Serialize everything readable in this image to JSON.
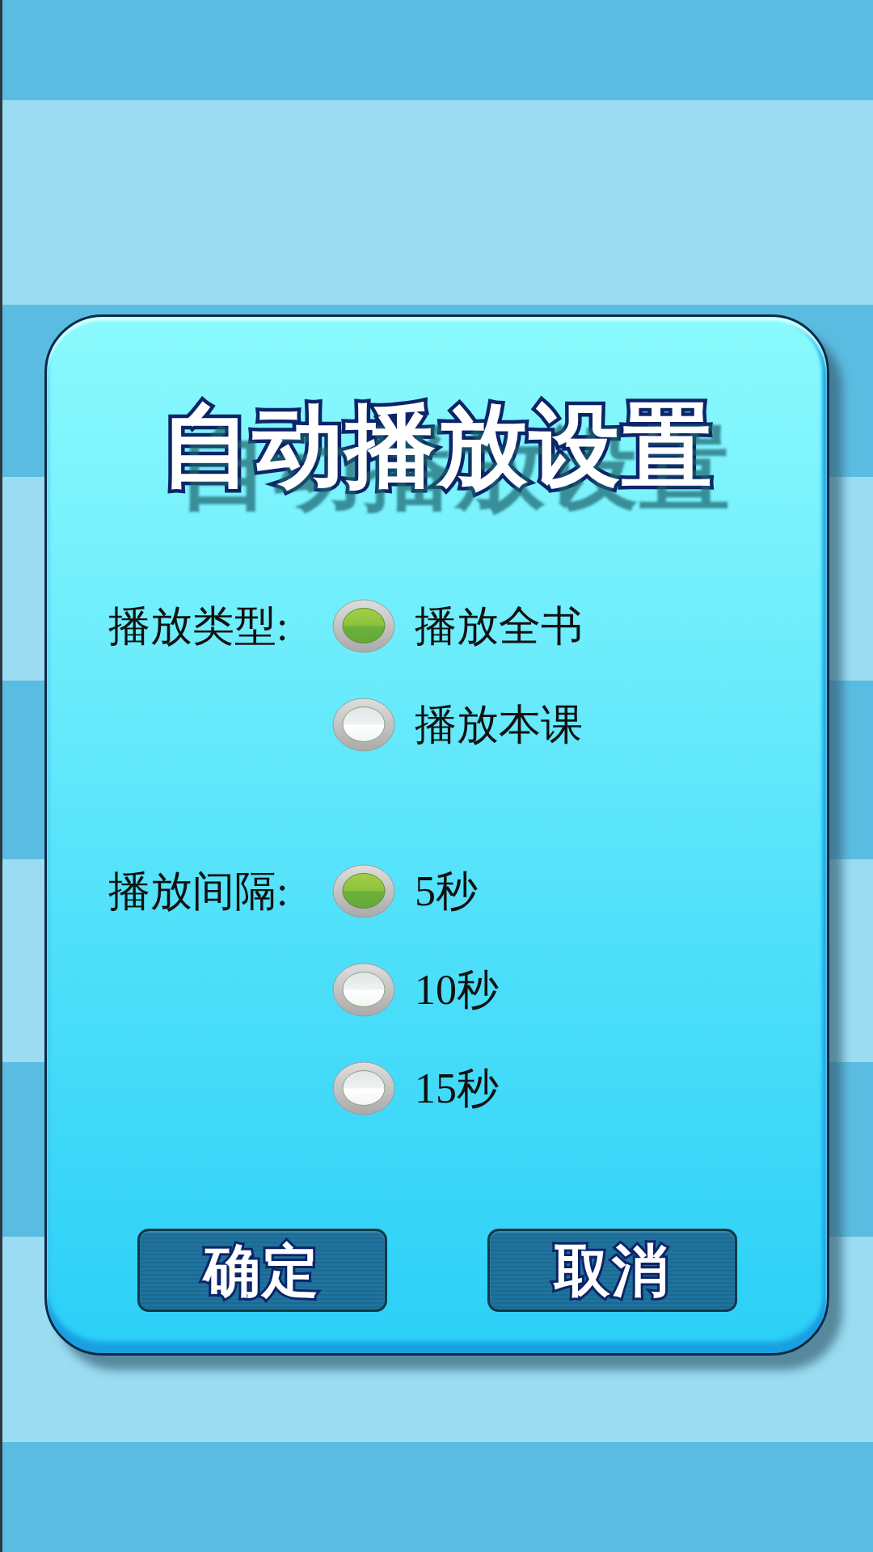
{
  "dialog": {
    "title": "自动播放设置",
    "groups": [
      {
        "label": "播放类型:",
        "options": [
          {
            "label": "播放全书",
            "selected": true
          },
          {
            "label": "播放本课",
            "selected": false
          }
        ]
      },
      {
        "label": "播放间隔:",
        "options": [
          {
            "label": "5秒",
            "selected": true
          },
          {
            "label": "10秒",
            "selected": false
          },
          {
            "label": "15秒",
            "selected": false
          }
        ]
      }
    ],
    "buttons": [
      "确定",
      "取消"
    ]
  }
}
